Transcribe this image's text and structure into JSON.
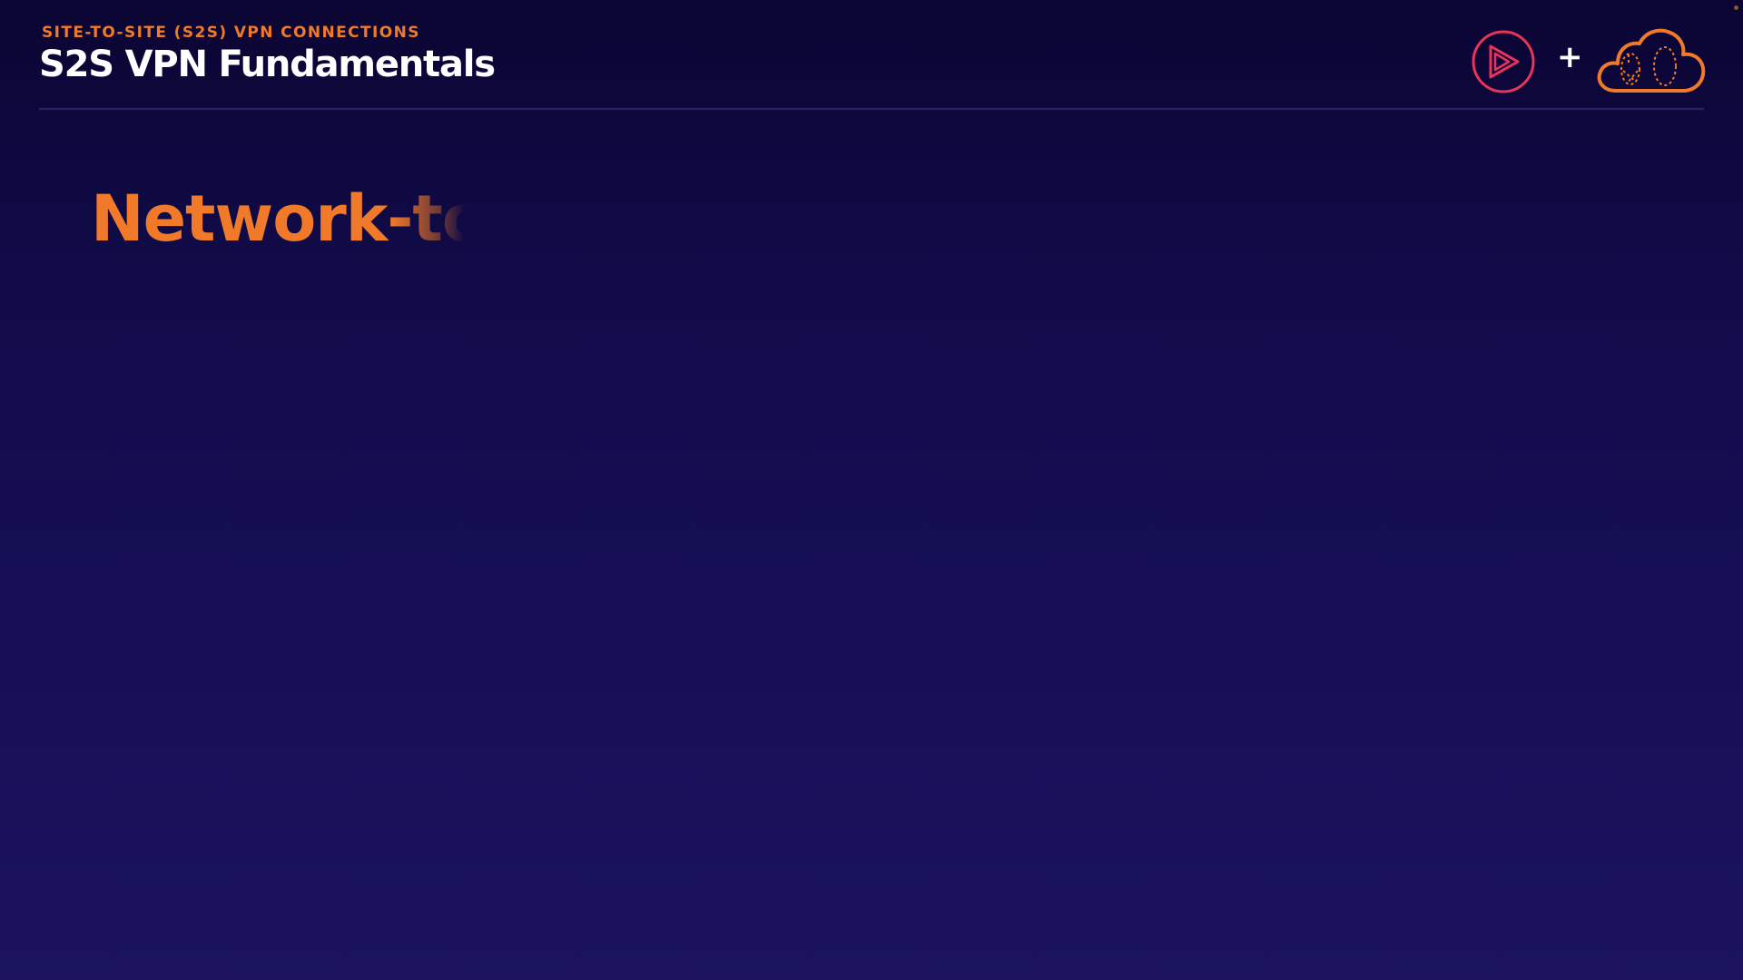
{
  "header": {
    "section_label": "SITE-TO-SITE (S2S) VPN CONNECTIONS",
    "title": "S2S VPN Fundamentals"
  },
  "logos": {
    "left_icon": "play-logo-icon",
    "separator": "+",
    "right_icon": "cloud-logo-icon"
  },
  "slide": {
    "heading": "Network-to"
  },
  "colors": {
    "accent": "#f07a2a",
    "play_logo": "#e8335a",
    "background_top": "#0b0533",
    "background_bottom": "#1b135e",
    "title": "#ffffff"
  }
}
